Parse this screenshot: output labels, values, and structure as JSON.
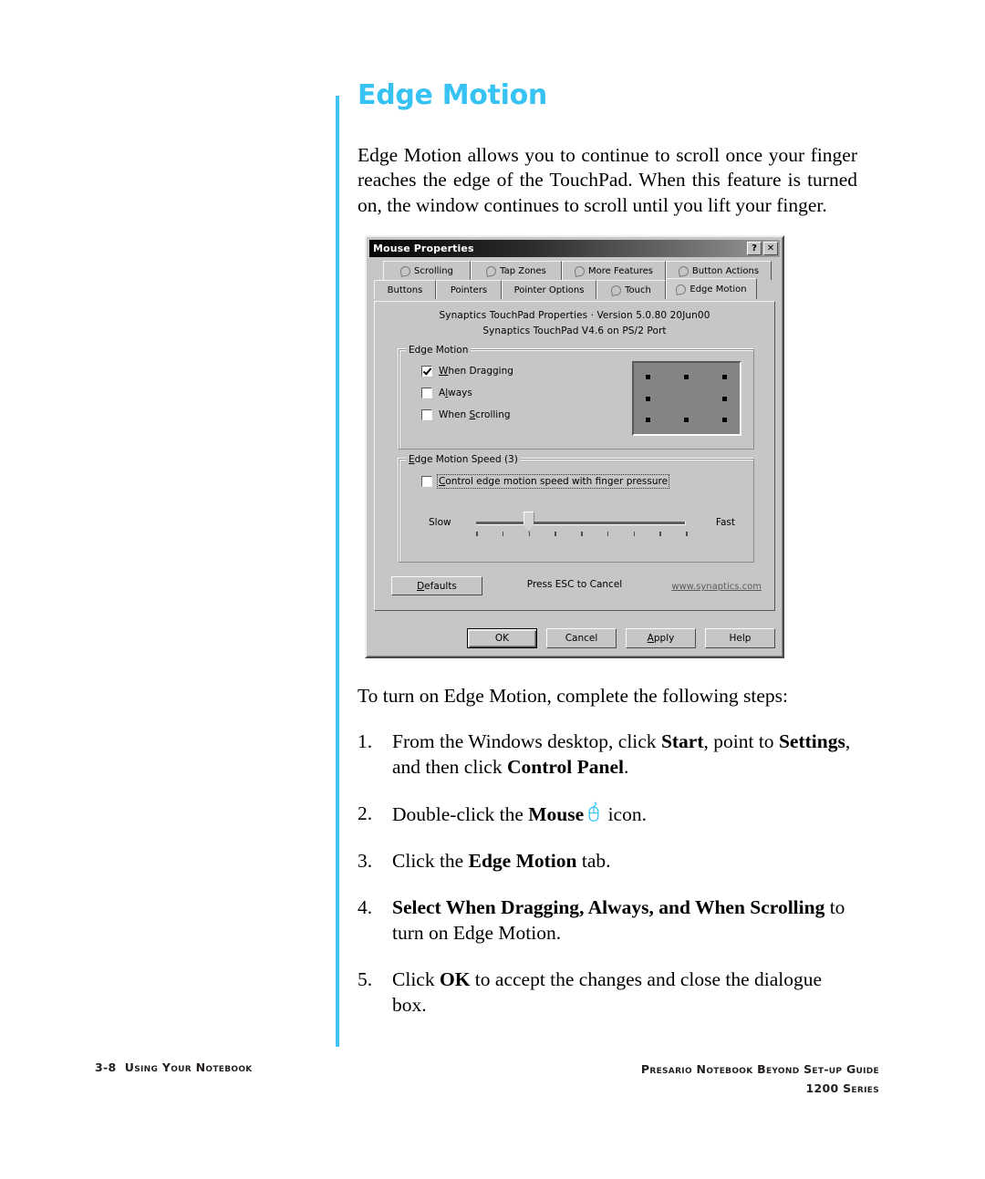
{
  "page": {
    "heading": "Edge Motion",
    "intro": "Edge Motion allows you to continue to scroll once your finger reaches the edge of the TouchPad. When this feature is turned on, the window continues to scroll until you lift your finger.",
    "lead": "To turn on Edge Motion, complete the following steps:",
    "accent_color": "#37c2f4",
    "rule_color": "#3fc4f5"
  },
  "steps": [
    {
      "num": "1.",
      "parts": [
        {
          "t": "From the Windows desktop, click ",
          "b": false
        },
        {
          "t": "Start",
          "b": true
        },
        {
          "t": ", point to ",
          "b": false
        },
        {
          "t": "Settings",
          "b": true
        },
        {
          "t": ", and then click ",
          "b": false
        },
        {
          "t": "Control Panel",
          "b": true
        },
        {
          "t": ".",
          "b": false
        }
      ]
    },
    {
      "num": "2.",
      "parts": [
        {
          "t": "Double-click the ",
          "b": false
        },
        {
          "t": "Mouse",
          "b": true
        },
        {
          "t": "ICON",
          "icon": "mouse-icon"
        },
        {
          "t": " icon.",
          "b": false
        }
      ]
    },
    {
      "num": "3.",
      "parts": [
        {
          "t": "Click the ",
          "b": false
        },
        {
          "t": "Edge Motion",
          "b": true
        },
        {
          "t": " tab.",
          "b": false
        }
      ]
    },
    {
      "num": "4.",
      "parts": [
        {
          "t": "Select ",
          "b": true
        },
        {
          "t": "When Dragging",
          "b": true
        },
        {
          "t": ", ",
          "b": true
        },
        {
          "t": "Always",
          "b": true
        },
        {
          "t": ", and ",
          "b": true
        },
        {
          "t": "When Scrolling",
          "b": true
        },
        {
          "t": " to turn on Edge Motion.",
          "b": false
        }
      ]
    },
    {
      "num": "5.",
      "parts": [
        {
          "t": "Click ",
          "b": false
        },
        {
          "t": "OK",
          "b": true
        },
        {
          "t": " to accept the changes and close the dialogue box.",
          "b": false
        }
      ]
    }
  ],
  "dialog": {
    "title": "Mouse Properties",
    "help_button": "?",
    "close_button": "✕",
    "tabs_row1": [
      {
        "label": "Scrolling",
        "selected": false
      },
      {
        "label": "Tap Zones",
        "selected": false
      },
      {
        "label": "More Features",
        "selected": false
      },
      {
        "label": "Button Actions",
        "selected": false
      }
    ],
    "tabs_row2": [
      {
        "label": "Buttons",
        "selected": false,
        "icon": false
      },
      {
        "label": "Pointers",
        "selected": false,
        "icon": false
      },
      {
        "label": "Pointer Options",
        "selected": false,
        "icon": false
      },
      {
        "label": "Touch",
        "selected": false,
        "icon": true
      },
      {
        "label": "Edge Motion",
        "selected": true,
        "icon": true
      }
    ],
    "version_line1": "Synaptics TouchPad Properties · Version 5.0.80 20Jun00",
    "version_line2": "Synaptics TouchPad V4.6 on PS/2 Port",
    "edge_motion_group": {
      "label": "Edge Motion",
      "checkboxes": [
        {
          "label_pre": "",
          "label_accel": "W",
          "label_post": "hen Dragging",
          "checked": true
        },
        {
          "label_pre": "A",
          "label_accel": "l",
          "label_post": "ways",
          "checked": false
        },
        {
          "label_pre": "When ",
          "label_accel": "S",
          "label_post": "crolling",
          "checked": false
        }
      ],
      "preview_dots": 8
    },
    "speed_group": {
      "label": "Edge Motion Speed (3)",
      "checkbox": {
        "label_pre": "",
        "label_accel": "C",
        "label_post": "ontrol edge motion speed with finger pressure",
        "checked": false,
        "focused": true
      },
      "slider": {
        "min_label": "Slow",
        "max_label": "Fast",
        "ticks": 9,
        "value_index": 2,
        "value": 3
      }
    },
    "defaults_button": {
      "pre": "",
      "accel": "D",
      "post": "efaults"
    },
    "esc_text": "Press ESC to Cancel",
    "web_link": "www.synaptics.com",
    "buttons": [
      {
        "label": "OK",
        "default": true,
        "accel": ""
      },
      {
        "label": "Cancel",
        "default": false,
        "accel": ""
      },
      {
        "label": "Apply",
        "default": false,
        "accel": "A"
      },
      {
        "label": "Help",
        "default": false,
        "accel": ""
      }
    ]
  },
  "footer": {
    "left_page": "3-8",
    "left_text": "Using Your Notebook",
    "right_line1": "Presario Notebook Beyond Set-up Guide",
    "right_line2": "1200 Series"
  }
}
